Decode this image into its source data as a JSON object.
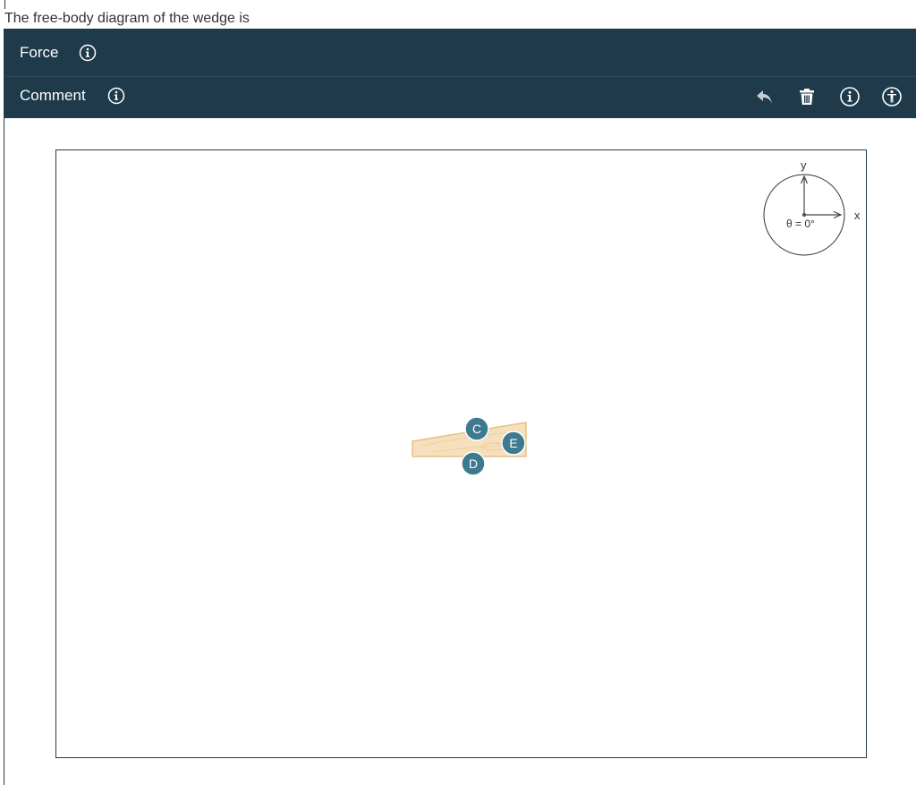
{
  "prompt": {
    "text": "The free-body diagram of the wedge is"
  },
  "toolbar": {
    "force_label": "Force",
    "comment_label": "Comment",
    "icons": {
      "info": "info-icon",
      "undo": "undo-icon",
      "delete": "trash-icon",
      "accessibility": "accessibility-icon"
    }
  },
  "canvas": {
    "axis": {
      "y_label": "y",
      "x_label": "x",
      "angle_label": "θ = 0°"
    },
    "wedge": {
      "points": [
        {
          "label": "C"
        },
        {
          "label": "E"
        },
        {
          "label": "D"
        }
      ]
    }
  },
  "colors": {
    "toolbar_bg": "#1e3a4b",
    "node_fill": "#3d7a8f",
    "wedge_fill": "#f6dfbd",
    "wedge_stroke": "#e8bf88"
  }
}
